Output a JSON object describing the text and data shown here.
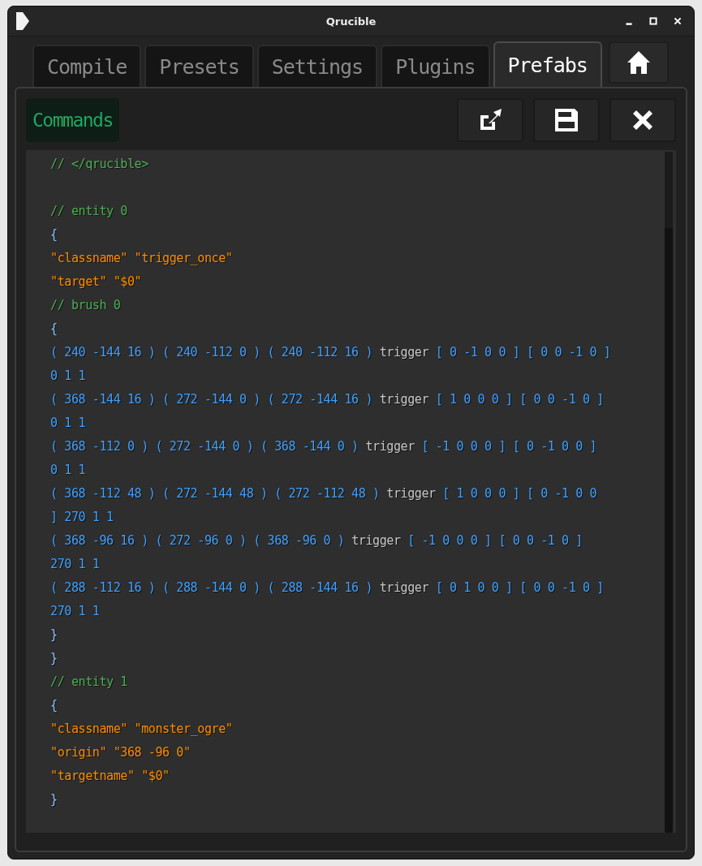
{
  "window": {
    "title": "Qrucible"
  },
  "tabs": [
    {
      "label": "Compile",
      "selected": false
    },
    {
      "label": "Presets",
      "selected": false
    },
    {
      "label": "Settings",
      "selected": false
    },
    {
      "label": "Plugins",
      "selected": false
    },
    {
      "label": "Prefabs",
      "selected": true
    }
  ],
  "toolbar": {
    "label": "Commands"
  },
  "editor": {
    "lines": [
      [
        {
          "kind": "comment",
          "text": "// </qrucible>"
        }
      ],
      [
        {
          "kind": "comment",
          "text": "// entity 0",
          "gap_before": true
        }
      ],
      [
        {
          "kind": "punct",
          "text": "{"
        }
      ],
      [
        {
          "kind": "string",
          "text": "\"classname\" \"trigger_once\""
        }
      ],
      [
        {
          "kind": "string",
          "text": "\"target\" \"$0\""
        }
      ],
      [
        {
          "kind": "comment",
          "text": "// brush 0"
        }
      ],
      [
        {
          "kind": "punct",
          "text": "{"
        }
      ],
      [
        {
          "kind": "number",
          "text": "( 240 -144 16 ) ( 240 -112 0 ) ( 240 -112 16 ) "
        },
        {
          "kind": "word",
          "text": "trigger"
        },
        {
          "kind": "number",
          "text": " [ 0 -1 0 0 ] [ 0 0 -1 0 ]"
        }
      ],
      [
        {
          "kind": "number",
          "text": "0 1 1"
        }
      ],
      [
        {
          "kind": "number",
          "text": "( 368 -144 16 ) ( 272 -144 0 ) ( 272 -144 16 ) "
        },
        {
          "kind": "word",
          "text": "trigger"
        },
        {
          "kind": "number",
          "text": " [ 1 0 0 0 ] [ 0 0 -1 0 ]"
        }
      ],
      [
        {
          "kind": "number",
          "text": "0 1 1"
        }
      ],
      [
        {
          "kind": "number",
          "text": "( 368 -112 0 ) ( 272 -144 0 ) ( 368 -144 0 ) "
        },
        {
          "kind": "word",
          "text": "trigger"
        },
        {
          "kind": "number",
          "text": " [ -1 0 0 0 ] [ 0 -1 0 0 ]"
        }
      ],
      [
        {
          "kind": "number",
          "text": "0 1 1"
        }
      ],
      [
        {
          "kind": "number",
          "text": "( 368 -112 48 ) ( 272 -144 48 ) ( 272 -112 48 ) "
        },
        {
          "kind": "word",
          "text": "trigger"
        },
        {
          "kind": "number",
          "text": " [ 1 0 0 0 ] [ 0 -1 0 0"
        }
      ],
      [
        {
          "kind": "number",
          "text": "] 270 1 1"
        }
      ],
      [
        {
          "kind": "number",
          "text": "( 368 -96 16 ) ( 272 -96 0 ) ( 368 -96 0 ) "
        },
        {
          "kind": "word",
          "text": "trigger"
        },
        {
          "kind": "number",
          "text": " [ -1 0 0 0 ] [ 0 0 -1 0 ]"
        }
      ],
      [
        {
          "kind": "number",
          "text": "270 1 1"
        }
      ],
      [
        {
          "kind": "number",
          "text": "( 288 -112 16 ) ( 288 -144 0 ) ( 288 -144 16 ) "
        },
        {
          "kind": "word",
          "text": "trigger"
        },
        {
          "kind": "number",
          "text": " [ 0 1 0 0 ] [ 0 0 -1 0 ]"
        }
      ],
      [
        {
          "kind": "number",
          "text": "270 1 1"
        }
      ],
      [
        {
          "kind": "punct",
          "text": "}"
        }
      ],
      [
        {
          "kind": "punct",
          "text": "}"
        }
      ],
      [
        {
          "kind": "comment",
          "text": "// entity 1"
        }
      ],
      [
        {
          "kind": "punct",
          "text": "{"
        }
      ],
      [
        {
          "kind": "string",
          "text": "\"classname\" \"monster_ogre\""
        }
      ],
      [
        {
          "kind": "string",
          "text": "\"origin\" \"368 -96 0\""
        }
      ],
      [
        {
          "kind": "string",
          "text": "\"targetname\" \"$0\""
        }
      ],
      [
        {
          "kind": "punct",
          "text": "}"
        }
      ]
    ]
  }
}
